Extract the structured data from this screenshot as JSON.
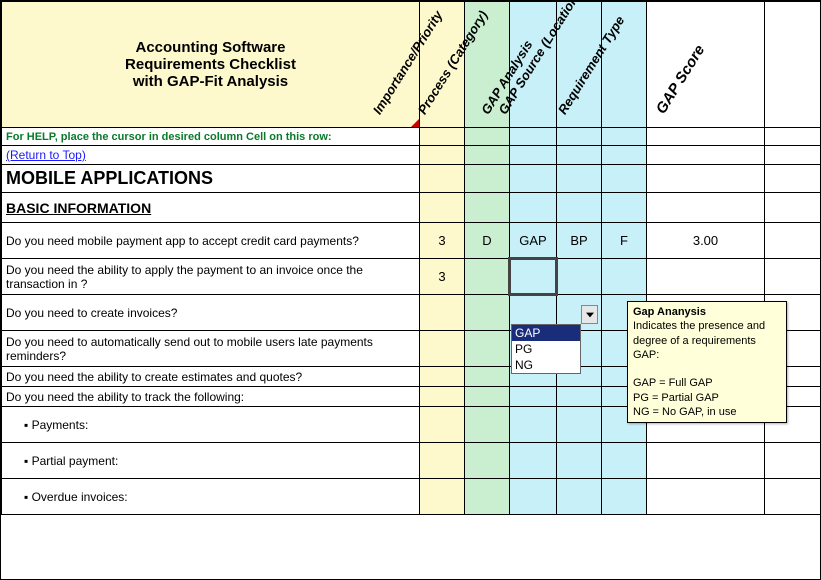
{
  "title_line1": "Accounting  Software",
  "title_line2": "Requirements Checklist",
  "title_line3": "with GAP-Fit Analysis",
  "headers": {
    "importance": "Importance/Priority",
    "process": "Process (Category)",
    "gap": "GAP Analysis",
    "source": "GAP Source (Location)",
    "reqtype": "Requirement Type",
    "score": "GAP Score"
  },
  "help_row": "For HELP, place the cursor in desired column Cell on this row:",
  "return_link": "(Return to Top)",
  "section": "MOBILE APPLICATIONS",
  "subsection": "BASIC INFORMATION",
  "rows": [
    {
      "text": "Do you need mobile payment app to accept credit card payments?",
      "imp": "3",
      "proc": "D",
      "gap": "GAP",
      "src": "BP",
      "rt": "F",
      "score": "3.00"
    },
    {
      "text": "Do you need the ability to apply the payment to an invoice once the transaction in ?",
      "imp": "3",
      "proc": "",
      "gap": "",
      "src": "",
      "rt": "",
      "score": ""
    },
    {
      "text": "Do you need to  create invoices?"
    },
    {
      "text": "Do you need to automatically send out to mobile users late payments reminders?"
    },
    {
      "text": "Do you need the ability to create estimates and quotes?"
    },
    {
      "text": "Do you need the ability to track the following:"
    },
    {
      "text": " ▪ Payments:"
    },
    {
      "text": " ▪ Partial payment:"
    },
    {
      "text": " ▪ Overdue invoices:"
    }
  ],
  "dropdown": {
    "opt1": "GAP",
    "opt2": "PG",
    "opt3": "NG"
  },
  "tooltip": {
    "title": "Gap Ananysis",
    "l1": "Indicates the presence and degree of a requirements GAP:",
    "l2": "GAP  = Full GAP",
    "l3": "PG = Partial GAP",
    "l4": "NG  = No GAP, in use"
  }
}
